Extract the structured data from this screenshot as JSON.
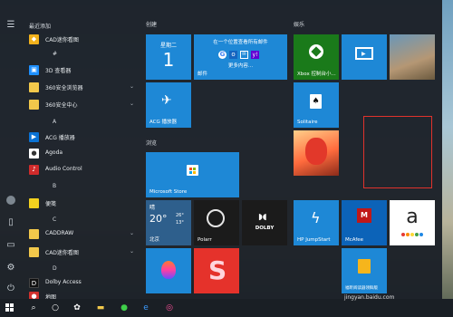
{
  "start_menu": {
    "left_rail": {
      "icons": [
        "hamburger-icon",
        "user-icon",
        "document-icon",
        "pictures-icon",
        "settings-icon",
        "power-icon"
      ]
    },
    "app_list": {
      "recent_header": "最近添加",
      "items": [
        {
          "label": "CAD迷你看图",
          "color": "#f2b21c",
          "icon": "cad-icon"
        },
        {
          "header": "#"
        },
        {
          "label": "3D 查看器",
          "color": "#1e90ff",
          "icon": "cube-icon"
        },
        {
          "label": "360安全浏览器",
          "color": "#f2c84b",
          "icon": "folder-icon",
          "chevron": "⌄"
        },
        {
          "label": "360安全中心",
          "color": "#f2c84b",
          "icon": "folder-icon",
          "chevron": "⌄"
        },
        {
          "header": "A"
        },
        {
          "label": "ACG 播放器",
          "color": "#0a72d4",
          "icon": "play-icon"
        },
        {
          "label": "Agoda",
          "color": "#ffffff",
          "icon": "agoda-icon"
        },
        {
          "label": "Audio Control",
          "color": "#d02b2b",
          "icon": "audio-icon"
        },
        {
          "header": "B"
        },
        {
          "label": "便笺",
          "color": "#f4d21f",
          "icon": "note-icon"
        },
        {
          "header": "C"
        },
        {
          "label": "CADDRAW",
          "color": "#f2c84b",
          "icon": "folder-icon",
          "chevron": "⌄"
        },
        {
          "label": "CAD迷你看图",
          "color": "#f2c84b",
          "icon": "folder-icon",
          "chevron": "⌄"
        },
        {
          "header": "D"
        },
        {
          "label": "Dolby Access",
          "color": "#111111",
          "icon": "dolby-icon"
        },
        {
          "label": "地图",
          "color": "#d0312d",
          "icon": "map-pin-icon"
        }
      ]
    },
    "sections": {
      "create": "创建",
      "browse": "浏览",
      "play": "娱乐"
    },
    "tiles": {
      "calendar": {
        "weekday": "星期二",
        "day": "1"
      },
      "mail": {
        "text": "在一个位置查看所有邮件",
        "sub": "更多内容...",
        "label": "邮件"
      },
      "acg": {
        "label": "ACG 播放器"
      },
      "xbox": {
        "label": "Xbox 控制台小..."
      },
      "solitaire": {
        "label": "Solitaire"
      },
      "msstore": {
        "label": "Microsoft Store"
      },
      "weather": {
        "condition": "晴",
        "temp": "20°",
        "high": "26°",
        "low": "13°",
        "city": "北京"
      },
      "polarr": {
        "label": "Polarr"
      },
      "dolby": {
        "text": "DOLBY"
      },
      "hpjump": {
        "label": "HP JumpStart"
      },
      "mcafee": {
        "label": "McAfee"
      },
      "amazon": {
        "letter": "a"
      },
      "fuyu": {
        "label": "福昕阅读器领鲜版"
      }
    }
  },
  "taskbar": {
    "icons": [
      "windows-icon",
      "search-icon",
      "cortana-icon",
      "taskview-icon",
      "explorer-icon",
      "browser-360-icon",
      "edge-icon",
      "app-icon"
    ]
  },
  "watermark": "jingyan.baidu.com"
}
